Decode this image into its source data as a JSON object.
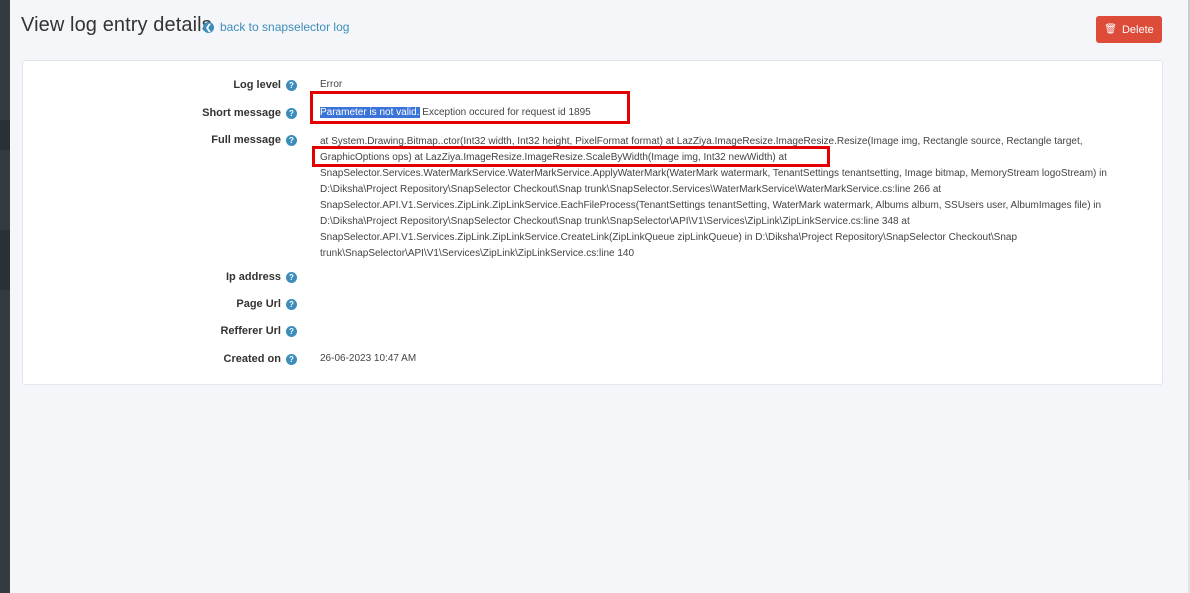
{
  "header": {
    "title": "View log entry details",
    "back_label": "back to snapselector log",
    "delete_label": "Delete"
  },
  "fields": {
    "log_level": {
      "label": "Log level",
      "value": "Error"
    },
    "short_message": {
      "label": "Short message",
      "selected": "Parameter is not valid.",
      "rest": " Exception occured for request id 1895"
    },
    "full_message": {
      "label": "Full message",
      "lines": [
        "at System.Drawing.Bitmap..ctor(Int32 width, Int32 height, PixelFormat format) at LazZiya.ImageResize.ImageResize.Resize(Image img, Rectangle source, Rectangle target,",
        "GraphicOptions ops) at LazZiya.ImageResize.ImageResize.ScaleByWidth(Image img, Int32 newWidth) at",
        "SnapSelector.Services.WaterMarkService.WaterMarkService.ApplyWaterMark(WaterMark watermark, TenantSettings tenantsetting, Image bitmap, MemoryStream logoStream) in",
        "D:\\Diksha\\Project Repository\\SnapSelector Checkout\\Snap trunk\\SnapSelector.Services\\WaterMarkService\\WaterMarkService.cs:line 266 at",
        "SnapSelector.API.V1.Services.ZipLink.ZipLinkService.EachFileProcess(TenantSettings tenantSetting, WaterMark watermark, Albums album, SSUsers user, AlbumImages file) in",
        "D:\\Diksha\\Project Repository\\SnapSelector Checkout\\Snap trunk\\SnapSelector\\API\\V1\\Services\\ZipLink\\ZipLinkService.cs:line 348 at",
        "SnapSelector.API.V1.Services.ZipLink.ZipLinkService.CreateLink(ZipLinkQueue zipLinkQueue) in D:\\Diksha\\Project Repository\\SnapSelector Checkout\\Snap",
        "trunk\\SnapSelector\\API\\V1\\Services\\ZipLink\\ZipLinkService.cs:line 140"
      ]
    },
    "ip_address": {
      "label": "Ip address",
      "value": ""
    },
    "page_url": {
      "label": "Page Url",
      "value": ""
    },
    "referrer_url": {
      "label": "Refferer Url",
      "value": ""
    },
    "created_on": {
      "label": "Created on",
      "value": "26-06-2023 10:47 AM"
    }
  },
  "help_glyph": "?",
  "colors": {
    "delete": "#dd4b39",
    "link": "#3c8dbc",
    "highlight": "#e20000",
    "selection": "#3b74d9"
  }
}
